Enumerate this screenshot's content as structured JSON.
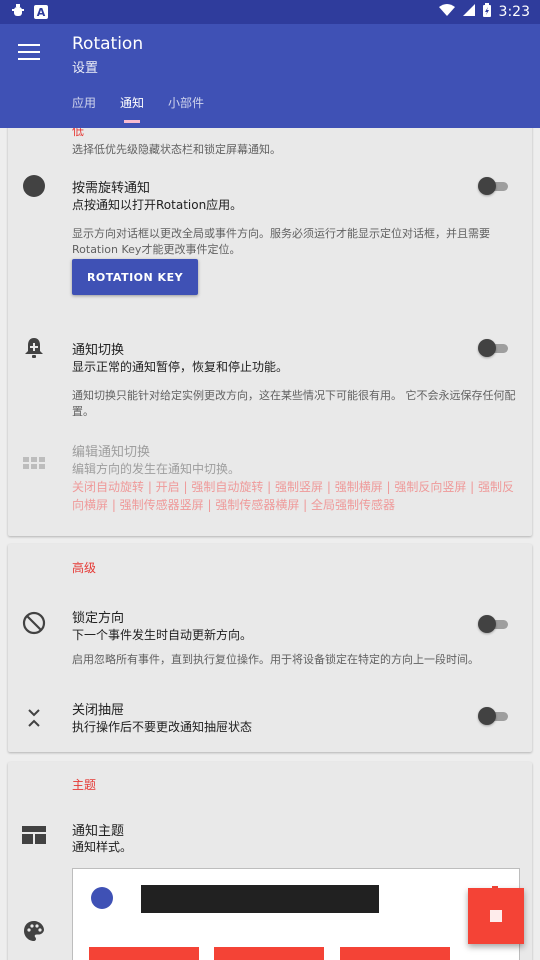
{
  "status_bar": {
    "left_icons": [
      "bug-icon",
      "a-box-icon"
    ],
    "a_box_text": "A",
    "right_icons": [
      "wifi-icon",
      "signal-icon",
      "battery-icon"
    ],
    "time": "3:23"
  },
  "app_bar": {
    "title": "Rotation",
    "subtitle": "设置",
    "tabs": [
      {
        "label": "应用",
        "active": false
      },
      {
        "label": "通知",
        "active": true
      },
      {
        "label": "小部件",
        "active": false
      }
    ]
  },
  "card1": {
    "section_label": "低",
    "section_desc": "选择低优先级隐藏状态栏和锁定屏幕通知。",
    "rotate_notification": {
      "title": "按需旋转通知",
      "subtitle": "点按通知以打开Rotation应用。",
      "desc": "显示方向对话框以更改全局或事件方向。服务必须运行才能显示定位对话框，并且需要Rotation Key才能更改事件定位。",
      "button": "ROTATION KEY",
      "enabled": false
    },
    "notification_toggle": {
      "title": "通知切换",
      "subtitle": "显示正常的通知暂停，恢复和停止功能。",
      "desc": "通知切换只能针对给定实例更改方向，这在某些情况下可能很有用。 它不会永远保存任何配置。",
      "enabled": false
    },
    "edit_toggles": {
      "title": "编辑通知切换",
      "subtitle": "编辑方向的发生在通知中切换。",
      "links": "关闭自动旋转 | 开启 | 强制自动旋转 | 强制竖屏 | 强制横屏 | 强制反向竖屏 | 强制反向横屏 | 强制传感器竖屏 | 强制传感器横屏 | 全局强制传感器"
    }
  },
  "card2": {
    "section_label": "高级",
    "lock_orientation": {
      "title": "锁定方向",
      "subtitle": "下一个事件发生时自动更新方向。",
      "desc": "启用忽略所有事件，直到执行复位操作。用于将设备锁定在特定的方向上一段时间。",
      "enabled": false
    },
    "close_drawer": {
      "title": "关闭抽屉",
      "subtitle": "执行操作后不要更改通知抽屉状态",
      "enabled": false
    }
  },
  "card3": {
    "section_label": "主题",
    "notification_theme": {
      "title": "通知主题",
      "subtitle": "通知样式。"
    }
  },
  "colors": {
    "primary": "#3f51b5",
    "primary_dark": "#2f3c9c",
    "accent": "#f44336",
    "tab_indicator": "#f8bbd0",
    "link_text": "#ef9a9a"
  }
}
